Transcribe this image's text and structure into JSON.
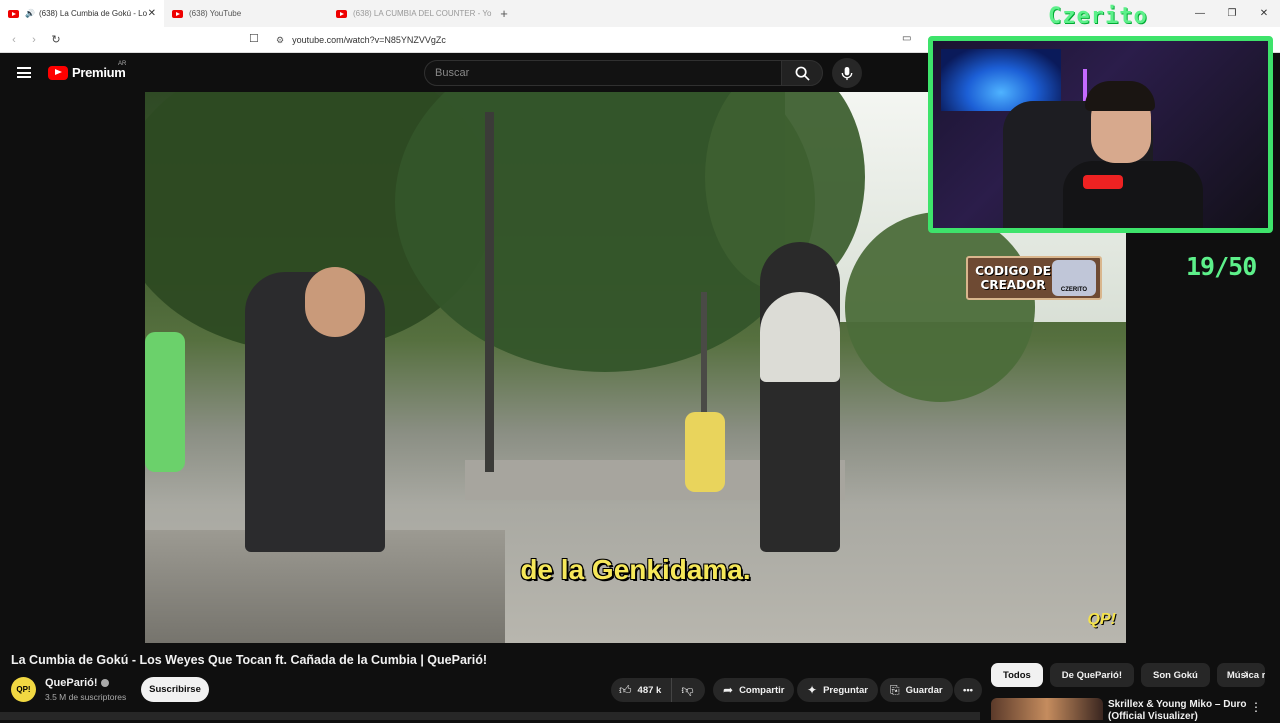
{
  "browser": {
    "tabs": [
      {
        "label": "(638) La Cumbia de Gokú - Lo",
        "active": true,
        "playing_audio": true
      },
      {
        "label": "(638) YouTube",
        "active": false
      },
      {
        "label": "(638) LA CUMBIA DEL COUNTER - Yo",
        "active": false
      }
    ],
    "url": "youtube.com/watch?v=N85YNZVVgZc",
    "new_tab_label": "+",
    "window_controls": [
      "minimize",
      "restore",
      "close"
    ]
  },
  "youtube_header": {
    "brand": "Premium",
    "country_code": "AR",
    "search_placeholder": "Buscar"
  },
  "video": {
    "subtitle": "de la Genkidama.",
    "watermark": "QP!"
  },
  "stream_overlay": {
    "streamer_name": "Czerito",
    "creator_code_label": "CODIGO DE CREADOR",
    "creator_code_badge": "CZERITO",
    "counter": "19/50",
    "cam_border_color": "#3ee36b"
  },
  "watch": {
    "title": "La Cumbia de Gokú - Los Weyes Que Tocan ft. Cañada de la Cumbia | QueParió!",
    "channel": "QueParió!",
    "subscribers": "3.5 M de suscriptores",
    "subscribe_label": "Suscribirse",
    "likes": "487 k",
    "share_label": "Compartir",
    "ask_label": "Preguntar",
    "save_label": "Guardar"
  },
  "chips": [
    "Todos",
    "De QueParió!",
    "Son Gokú",
    "Música re"
  ],
  "recommendation": {
    "title_line1": "Skrillex & Young Miko – Duro",
    "title_line2": "(Official Visualizer)"
  }
}
